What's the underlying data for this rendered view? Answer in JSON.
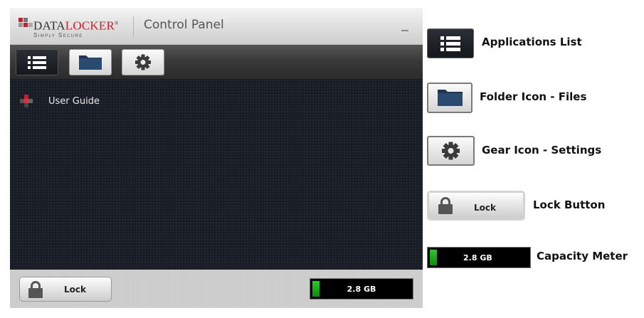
{
  "window": {
    "logo_word_part1": "Data",
    "logo_word_part2": "Locker",
    "logo_registered": "®",
    "logo_tagline": "Simply Secure",
    "title": "Control Panel"
  },
  "toolbar": {
    "buttons": [
      {
        "name": "applications-list",
        "icon": "list-icon"
      },
      {
        "name": "files",
        "icon": "folder-icon"
      },
      {
        "name": "settings",
        "icon": "gear-icon"
      }
    ]
  },
  "applications": [
    {
      "label": "User Guide",
      "icon": "datalocker-icon"
    }
  ],
  "status": {
    "lock_label": "Lock",
    "capacity_text": "2.8 GB",
    "capacity_fill": 0.07
  },
  "legend": {
    "items": [
      {
        "icon": "list-icon",
        "label": "Applications List"
      },
      {
        "icon": "folder-icon",
        "label": "Folder Icon - Files"
      },
      {
        "icon": "gear-icon",
        "label": "Gear Icon - Settings"
      },
      {
        "icon": "lock-button",
        "label": "Lock Button",
        "button_label": "Lock"
      },
      {
        "icon": "capacity-meter",
        "label": "Capacity Meter",
        "meter_text": "2.8 GB"
      }
    ]
  },
  "colors": {
    "brand_red": "#c8202f",
    "meter_green": "#1fa81f",
    "content_bg": "#181c24"
  }
}
